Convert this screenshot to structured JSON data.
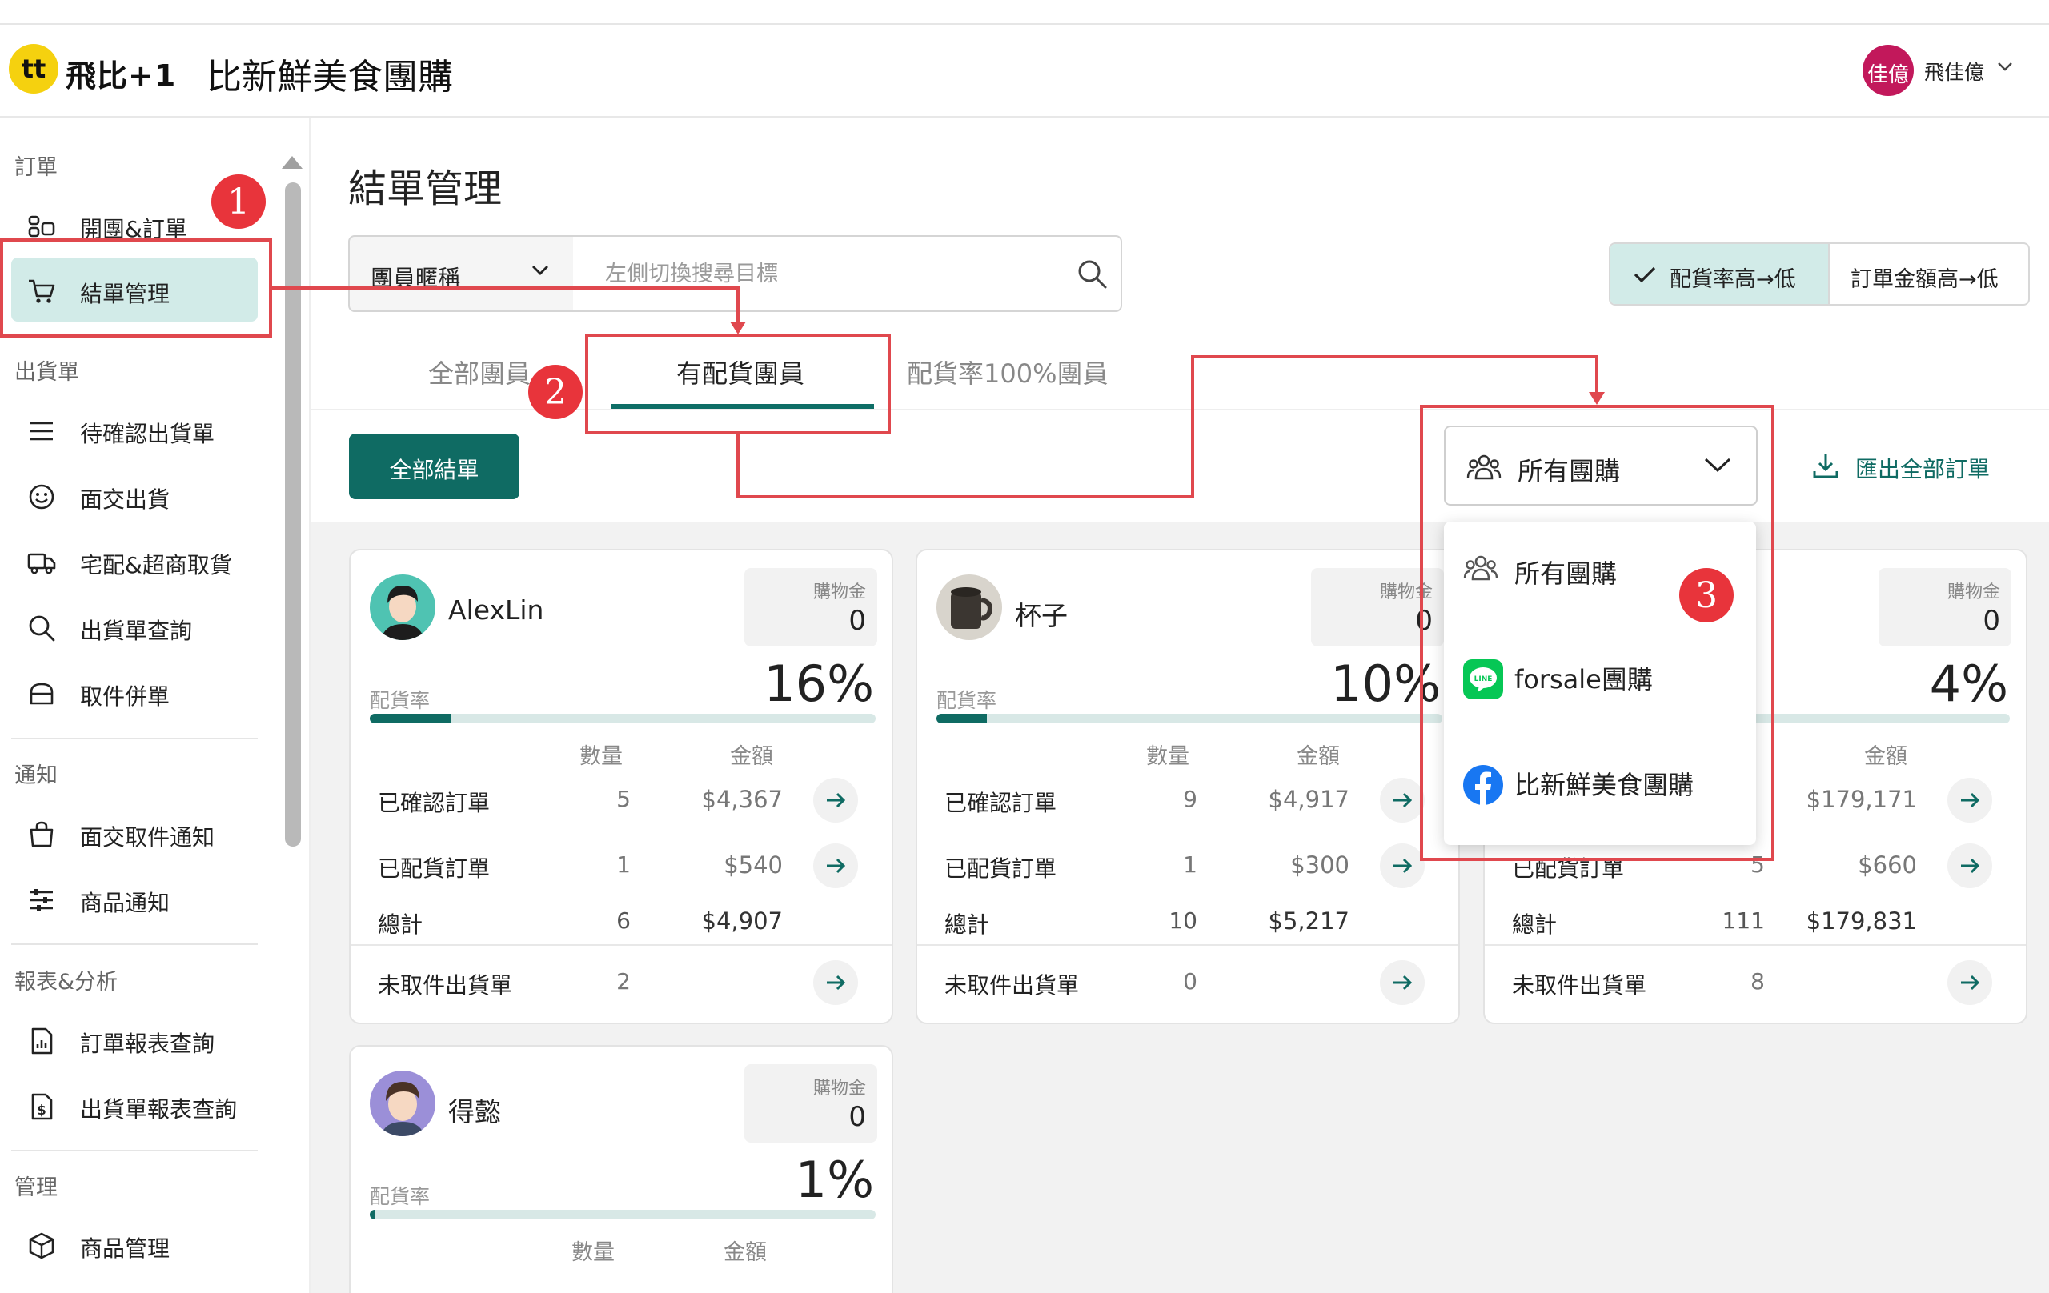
{
  "header": {
    "logo_text": "tt",
    "brand": "飛比+1",
    "shop_title": "比新鮮美食團購",
    "user_avatar_text": "佳億",
    "user_name": "飛佳億"
  },
  "sidebar": {
    "sections": [
      {
        "label": "訂單"
      },
      {
        "label": "出貨單"
      },
      {
        "label": "通知"
      },
      {
        "label": "報表&分析"
      },
      {
        "label": "管理"
      }
    ],
    "items": [
      {
        "label": "開團&訂單",
        "icon": "grid-icon"
      },
      {
        "label": "結單管理",
        "icon": "cart-icon",
        "active": true
      },
      {
        "label": "待確認出貨單",
        "icon": "list-icon"
      },
      {
        "label": "面交出貨",
        "icon": "smile-icon"
      },
      {
        "label": "宅配&超商取貨",
        "icon": "truck-icon"
      },
      {
        "label": "出貨單查詢",
        "icon": "search-icon"
      },
      {
        "label": "取件併單",
        "icon": "box-icon"
      },
      {
        "label": "面交取件通知",
        "icon": "bag-icon"
      },
      {
        "label": "商品通知",
        "icon": "sliders-icon"
      },
      {
        "label": "訂單報表查詢",
        "icon": "report-icon"
      },
      {
        "label": "出貨單報表查詢",
        "icon": "dollar-report-icon"
      },
      {
        "label": "商品管理",
        "icon": "cube-icon"
      }
    ]
  },
  "main": {
    "page_title": "結單管理",
    "search": {
      "field_select": "團員暱稱",
      "placeholder": "左側切換搜尋目標",
      "value": ""
    },
    "sort": {
      "option_a": "配貨率高→低",
      "option_b": "訂單金額高→低",
      "selected": "option_a"
    },
    "tabs": [
      {
        "label": "全部團員"
      },
      {
        "label": "有配貨團員",
        "active": true
      },
      {
        "label": "配貨率100%團員"
      }
    ],
    "close_all_button": "全部結單",
    "group_filter": {
      "selected": "所有團購",
      "options": [
        {
          "label": "所有團購",
          "icon": "group-icon"
        },
        {
          "label": "forsale團購",
          "icon": "line-icon"
        },
        {
          "label": "比新鮮美食團購",
          "icon": "facebook-icon"
        }
      ]
    },
    "export_label": "匯出全部訂單",
    "card_labels": {
      "credit": "購物金",
      "rate": "配貨率",
      "qty_header": "數量",
      "amount_header": "金額",
      "confirmed": "已確認訂單",
      "allocated": "已配貨訂單",
      "total": "總計",
      "unpicked": "未取件出貨單"
    },
    "members": [
      {
        "name": "AlexLin",
        "credit": "0",
        "rate": "16%",
        "rate_value": 0.16,
        "confirmed": {
          "qty": "5",
          "amount": "$4,367"
        },
        "allocated": {
          "qty": "1",
          "amount": "$540"
        },
        "total": {
          "qty": "6",
          "amount": "$4,907"
        },
        "unpicked": {
          "qty": "2"
        }
      },
      {
        "name": "杯子",
        "credit": "0",
        "rate": "10%",
        "rate_value": 0.1,
        "confirmed": {
          "qty": "9",
          "amount": "$4,917"
        },
        "allocated": {
          "qty": "1",
          "amount": "$300"
        },
        "total": {
          "qty": "10",
          "amount": "$5,217"
        },
        "unpicked": {
          "qty": "0"
        }
      },
      {
        "name": "",
        "credit": "0",
        "rate": "4%",
        "rate_value": 0.04,
        "confirmed": {
          "qty": "",
          "amount": "$179,171"
        },
        "allocated": {
          "qty": "5",
          "amount": "$660"
        },
        "total": {
          "qty": "111",
          "amount": "$179,831"
        },
        "unpicked": {
          "qty": "8"
        }
      },
      {
        "name": "得懿",
        "credit": "0",
        "rate": "1%",
        "rate_value": 0.01
      }
    ]
  },
  "annotations": {
    "badge_1": "1",
    "badge_2": "2",
    "badge_3": "3"
  },
  "colors": {
    "accent": "#0f6b63",
    "accent_light": "#d2ebe8",
    "annotation_red": "#e0484e",
    "logo_yellow": "#f5d10f"
  }
}
